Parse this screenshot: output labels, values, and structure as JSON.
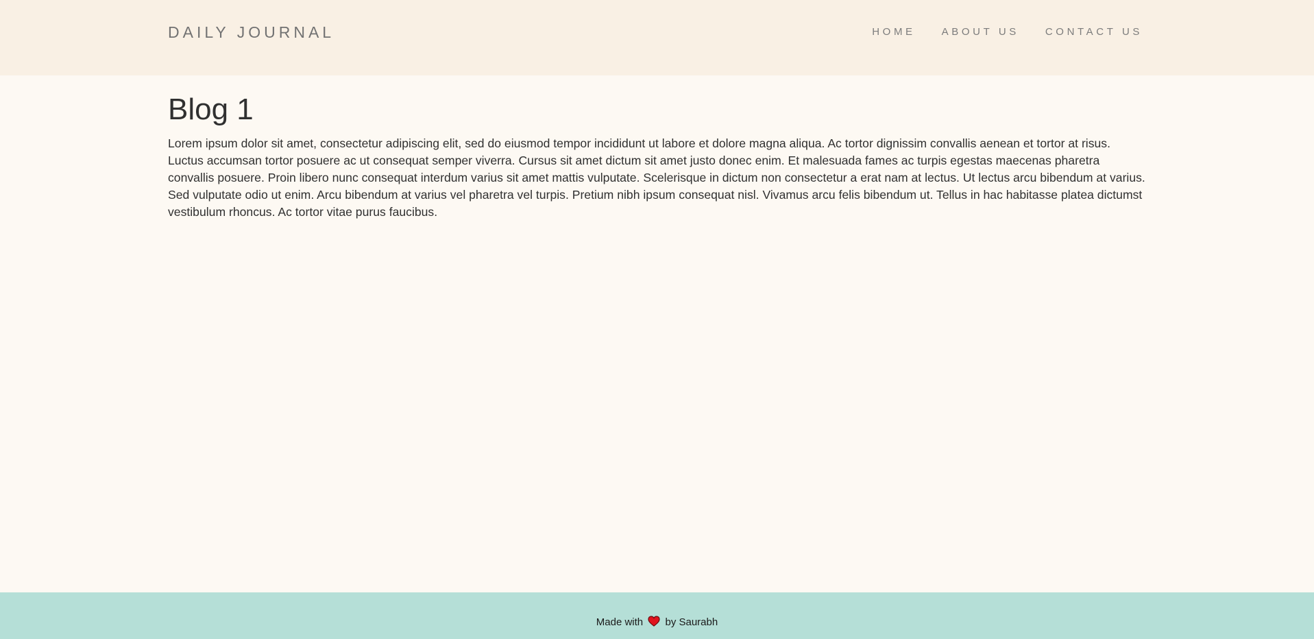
{
  "header": {
    "brand": "DAILY JOURNAL",
    "nav": [
      {
        "label": "HOME"
      },
      {
        "label": "ABOUT US"
      },
      {
        "label": "CONTACT US"
      }
    ]
  },
  "post": {
    "title": "Blog 1",
    "body": "Lorem ipsum dolor sit amet, consectetur adipiscing elit, sed do eiusmod tempor incididunt ut labore et dolore magna aliqua. Ac tortor dignissim convallis aenean et tortor at risus. Luctus accumsan tortor posuere ac ut consequat semper viverra. Cursus sit amet dictum sit amet justo donec enim. Et malesuada fames ac turpis egestas maecenas pharetra convallis posuere. Proin libero nunc consequat interdum varius sit amet mattis vulputate. Scelerisque in dictum non consectetur a erat nam at lectus. Ut lectus arcu bibendum at varius. Sed vulputate odio ut enim. Arcu bibendum at varius vel pharetra vel turpis. Pretium nibh ipsum consequat nisl. Vivamus arcu felis bibendum ut. Tellus in hac habitasse platea dictumst vestibulum rhoncus. Ac tortor vitae purus faucibus."
  },
  "footer": {
    "prefix": "Made with",
    "icon": "heart-icon",
    "suffix": "by Saurabh"
  },
  "colors": {
    "header_bg": "#f9f0e4",
    "page_bg": "#fdf9f3",
    "footer_bg": "#b5dfd7",
    "heart": "#e0141e"
  }
}
